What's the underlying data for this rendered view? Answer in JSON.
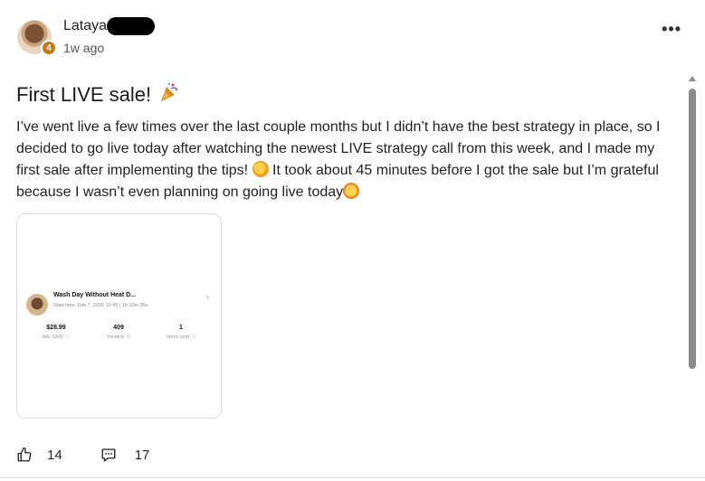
{
  "post": {
    "author_name": "Lataya",
    "level_badge": "4",
    "time_ago": "1w ago",
    "more_label": "•••",
    "title": "First LIVE sale!",
    "title_icon": "party-popper-icon",
    "body_part1": "I’ve went live a few times over the last couple months but I didn’t have the best strategy in place, so I decided to go live today after watching the newest LIVE strategy call from this week, and I made my first sale after implementing the tips! ",
    "body_emoji1": "face-blowing-kiss-icon",
    "body_part2": " It took about 45 minutes before I got the sale but I’m grateful because I wasn’t even planning on going live today",
    "body_emoji2": "crying-face-icon"
  },
  "attachment": {
    "show_title": "Wash Day Without Heat D...",
    "start_time": "Start time: Feb 7, 2026 10:49  |  1h 10m 35s",
    "stats": [
      {
        "value": "$28.99",
        "label": "Attr. GMV ⓘ"
      },
      {
        "value": "409",
        "label": "Viewers ⓘ"
      },
      {
        "value": "1",
        "label": "Items sold ⓘ"
      }
    ]
  },
  "engagement": {
    "likes": "14",
    "comments": "17"
  },
  "colors": {
    "badge": "#c07c1a",
    "scrollbar": "#8a8a8a"
  }
}
